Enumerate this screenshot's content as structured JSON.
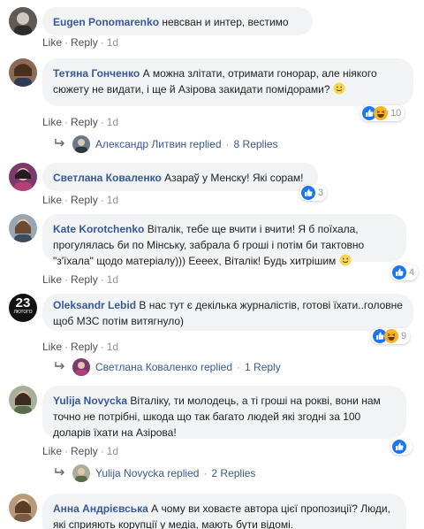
{
  "colors": {
    "link": "#385898",
    "like_blue": "#1877f2",
    "haha_yellow": "#f7b125",
    "bubble": "#f2f3f5"
  },
  "actions": {
    "like": "Like",
    "reply": "Reply",
    "sep": "·",
    "time": "1d"
  },
  "comments": [
    {
      "author": "Eugen Ponomarenko",
      "text": "невсван и интер, вестимо"
    },
    {
      "author": "Тетяна Гонченко",
      "text": "А можна злітати, отримати гонорар, але ніякого сюжету не видати, і ще й Азірова закидати помідорами?",
      "reactions": {
        "icons": [
          "like-icon",
          "haha-icon"
        ],
        "count": "10"
      }
    },
    {
      "author": "Светлана Коваленко",
      "text": "Азараў у Менску! Які сорам!",
      "reactions": {
        "icons": [
          "like-icon"
        ],
        "count": "3"
      }
    },
    {
      "author": "Kate Korotchenko",
      "text": "Віталік, тебе ще вчити і вчити! Я б поїхала, прогулялась би по Мінську, забрала б гроші і потім би тактовно \"з'їхала\" щодо матеріалу))) Ееееx, Віталік! Будь хитрішим",
      "reactions": {
        "icons": [
          "like-icon"
        ],
        "count": "4"
      }
    },
    {
      "author": "Oleksandr Lebid",
      "text": "В нас тут є декілька журналістів, готові їхати..головне щоб МЗС потім витягнуло)",
      "reactions": {
        "icons": [
          "like-icon",
          "haha-icon"
        ],
        "count": "9"
      },
      "avatar_text": {
        "top": "23",
        "bottom": "ЛЮТОГО"
      }
    },
    {
      "author": "Yulija Novycka",
      "text": "Віталіку, ти молодець, а ті гроші на рокві, вони нам точно не потрібні, шкода що так багато людей які згодні за 100 доларів їхати на Азірова!",
      "reactions": {
        "icons": [
          "like-icon"
        ],
        "count": ""
      }
    },
    {
      "author": "Анна Андрієвська",
      "text": "А чому ви ховаєте автора цієї пропозиції? Люди, які сприяють корупції у медіа, мають бути відомі."
    }
  ],
  "replies": [
    {
      "name": "Александр Литвин replied",
      "count": "8 Replies"
    },
    {
      "name": "Светлана Коваленко replied",
      "count": "1 Reply"
    },
    {
      "name": "Yulija Novycka replied",
      "count": "2 Replies"
    }
  ]
}
